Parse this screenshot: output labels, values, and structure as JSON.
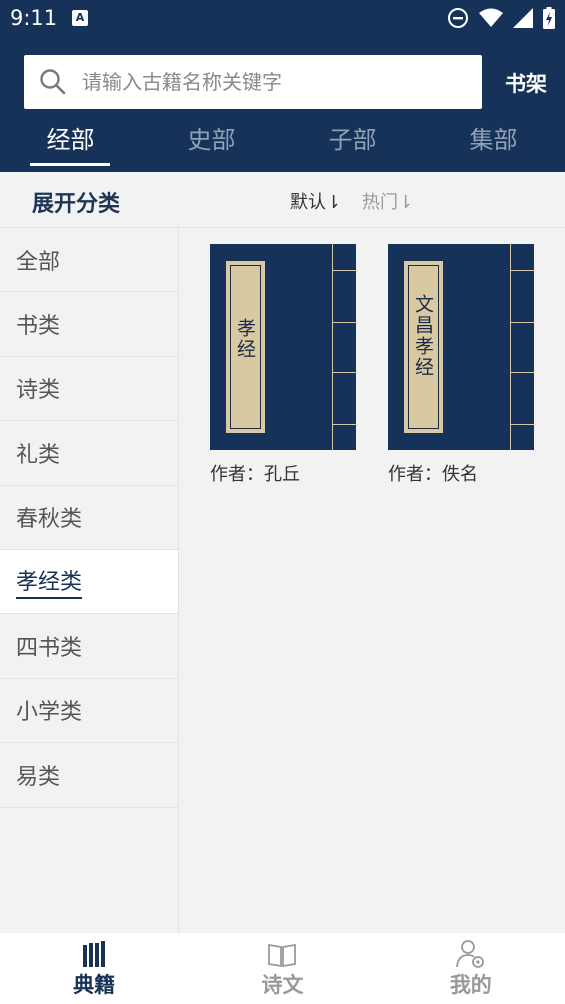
{
  "status_bar": {
    "time": "9:11",
    "notification_letter": "A"
  },
  "search": {
    "placeholder": "请输入古籍名称关键字",
    "value": ""
  },
  "header": {
    "bookshelf_label": "书架"
  },
  "tabs": [
    {
      "label": "经部",
      "active": true
    },
    {
      "label": "史部",
      "active": false
    },
    {
      "label": "子部",
      "active": false
    },
    {
      "label": "集部",
      "active": false
    }
  ],
  "filter": {
    "expand_label": "展开分类",
    "sort_default": "默认⇂",
    "sort_hot": "热门⇂"
  },
  "categories": [
    {
      "label": "全部"
    },
    {
      "label": "书类"
    },
    {
      "label": "诗类"
    },
    {
      "label": "礼类"
    },
    {
      "label": "春秋类"
    },
    {
      "label": "孝经类",
      "active": true
    },
    {
      "label": "四书类"
    },
    {
      "label": "小学类"
    },
    {
      "label": "易类"
    }
  ],
  "books": [
    {
      "title": "孝经",
      "author": "作者：孔丘"
    },
    {
      "title": "文昌孝经",
      "author": "作者：佚名"
    }
  ],
  "bottom_nav": [
    {
      "label": "典籍",
      "icon": "books-icon",
      "active": true
    },
    {
      "label": "诗文",
      "icon": "open-book-icon",
      "active": false
    },
    {
      "label": "我的",
      "icon": "user-settings-icon",
      "active": false
    }
  ],
  "colors": {
    "primary": "#163259",
    "paper": "#d8c9a3",
    "background": "#f2f2f2"
  }
}
